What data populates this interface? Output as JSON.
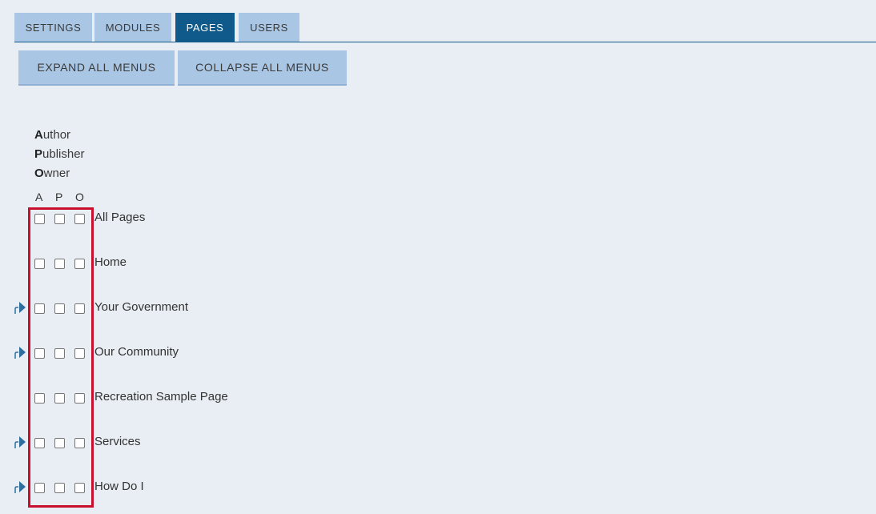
{
  "tabs": {
    "settings": "SETTINGS",
    "modules": "MODULES",
    "pages": "PAGES",
    "users": "USERS"
  },
  "actions": {
    "expand": "EXPAND ALL MENUS",
    "collapse": "COLLAPSE ALL MENUS"
  },
  "legend": {
    "author_initial": "A",
    "author_rest": "uthor",
    "publisher_initial": "P",
    "publisher_rest": "ublisher",
    "owner_initial": "O",
    "owner_rest": "wner"
  },
  "columns": {
    "a": "A",
    "p": "P",
    "o": "O"
  },
  "rows": [
    {
      "label": "All Pages",
      "expandable": false
    },
    {
      "label": "Home",
      "expandable": false
    },
    {
      "label": "Your Government",
      "expandable": true
    },
    {
      "label": "Our Community",
      "expandable": true
    },
    {
      "label": "Recreation Sample Page",
      "expandable": false
    },
    {
      "label": "Services",
      "expandable": true
    },
    {
      "label": "How Do I",
      "expandable": true
    }
  ],
  "colors": {
    "active_tab": "#0f5a8a",
    "tab": "#a9c6e4",
    "highlight": "#c8102e",
    "background": "#e8eef3"
  }
}
